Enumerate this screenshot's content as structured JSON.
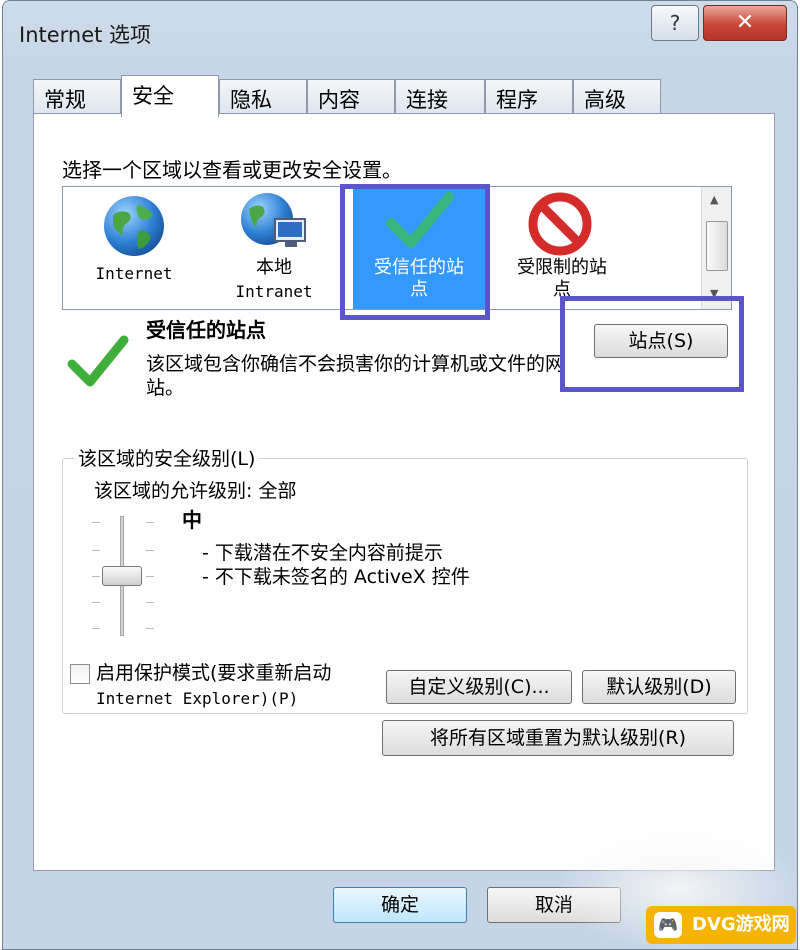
{
  "window": {
    "title": "Internet 选项",
    "help_glyph": "?",
    "close_glyph": "✕"
  },
  "tabs": [
    "常规",
    "安全",
    "隐私",
    "内容",
    "连接",
    "程序",
    "高级"
  ],
  "active_tab": "安全",
  "security": {
    "prompt": "选择一个区域以查看或更改安全设置。",
    "zones": [
      {
        "label": "Internet"
      },
      {
        "label": "本地",
        "sublabel": "Intranet"
      },
      {
        "label": "受信任的站",
        "sublabel": "点"
      },
      {
        "label": "受限制的站",
        "sublabel": "点"
      }
    ],
    "selected_zone_index": 2,
    "zone_title": "受信任的站点",
    "zone_desc": "该区域包含你确信不会损害你的计算机或文件的网站。",
    "sites_button": "站点(S)",
    "level_group_title": "该区域的安全级别(L)",
    "allowed_levels": "该区域的允许级别: 全部",
    "level_name": "中",
    "level_lines": [
      "- 下载潜在不安全内容前提示",
      "- 不下载未签名的 ActiveX 控件"
    ],
    "protected_mode_line1": "启用保护模式(要求重新启动",
    "protected_mode_line2": "Internet Explorer)(P)",
    "protected_mode_checked": false,
    "custom_level_button": "自定义级别(C)...",
    "default_level_button": "默认级别(D)",
    "reset_all_button": "将所有区域重置为默认级别(R)"
  },
  "footer": {
    "ok_button": "确定",
    "cancel_button": "取消"
  },
  "watermark": {
    "text": "DVG游戏网"
  },
  "colors": {
    "highlight_box": "#5a55c9",
    "selected_zone": "#3399ff",
    "close_button": "#c9473a"
  }
}
